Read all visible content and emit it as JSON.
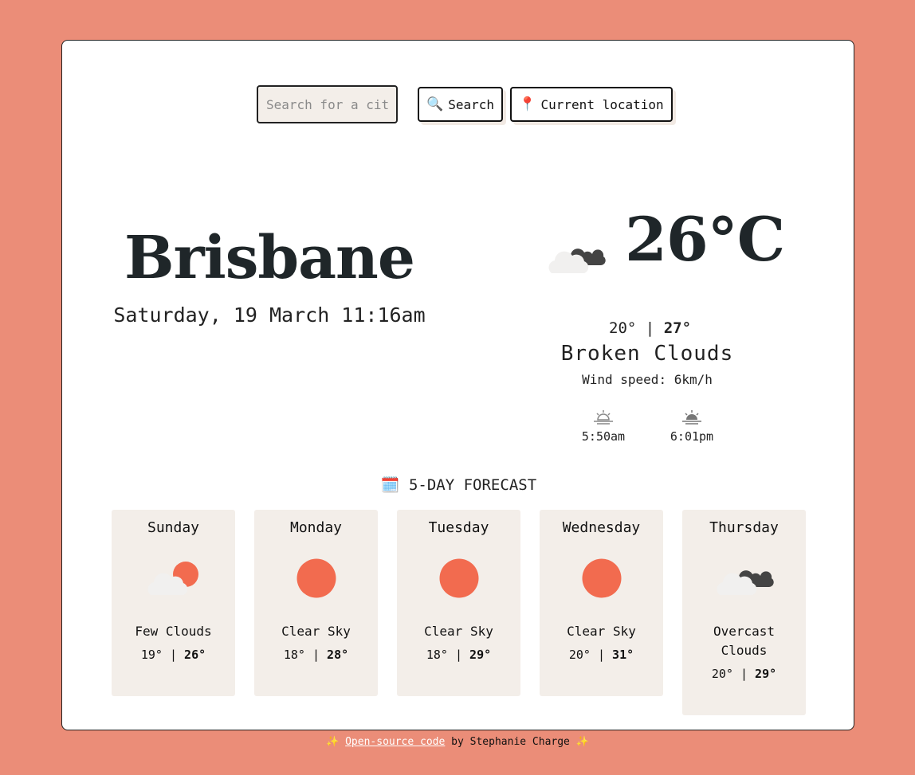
{
  "search": {
    "placeholder": "Search for a city",
    "button_label": "Search",
    "location_label": "Current location",
    "search_icon": "magnifier-icon",
    "location_icon": "pin-icon"
  },
  "current": {
    "city": "Brisbane",
    "datetime": "Saturday, 19 March 11:16am",
    "temperature": "26°C",
    "min": "20°",
    "max": "27°",
    "separator": "|",
    "description": "Broken Clouds",
    "wind": "Wind speed: 6km/h",
    "sunrise": "5:50am",
    "sunset": "6:01pm",
    "icon": "broken-clouds-icon"
  },
  "forecast": {
    "title": "5-DAY FORECAST",
    "title_icon": "calendar-icon",
    "days": [
      {
        "day": "Sunday",
        "desc": "Few Clouds",
        "min": "19°",
        "max": "26°",
        "icon": "few-clouds-icon"
      },
      {
        "day": "Monday",
        "desc": "Clear Sky",
        "min": "18°",
        "max": "28°",
        "icon": "sun-icon"
      },
      {
        "day": "Tuesday",
        "desc": "Clear Sky",
        "min": "18°",
        "max": "29°",
        "icon": "sun-icon"
      },
      {
        "day": "Wednesday",
        "desc": "Clear Sky",
        "min": "20°",
        "max": "31°",
        "icon": "sun-icon"
      },
      {
        "day": "Thursday",
        "desc": "Overcast Clouds",
        "min": "20°",
        "max": "29°",
        "icon": "overcast-clouds-icon"
      }
    ]
  },
  "footer": {
    "sparkle": "✨",
    "link_text": "Open-source code",
    "text": "by Stephanie Charge"
  },
  "colors": {
    "background": "#eb8d78",
    "accent": "#f26b4f",
    "card_tint": "#f3eee9"
  }
}
